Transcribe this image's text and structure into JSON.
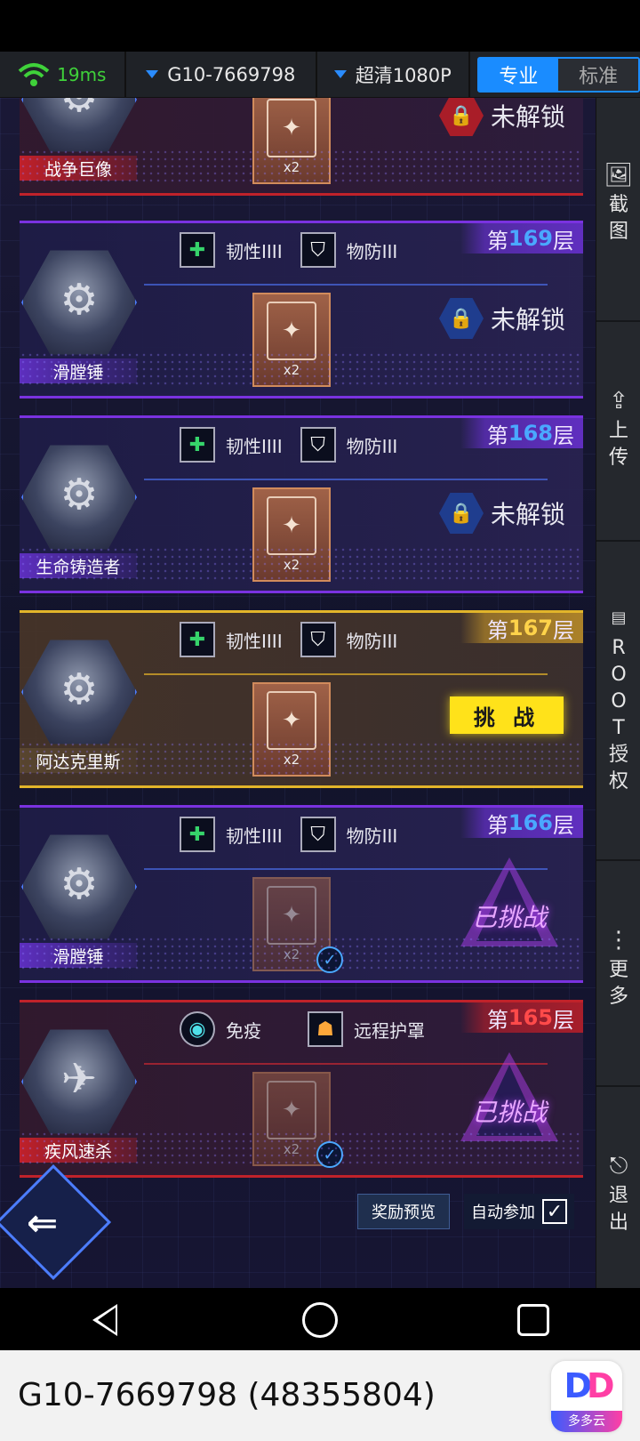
{
  "toolbar": {
    "ping": "19ms",
    "device": "G10-7669798",
    "quality": "超清1080P",
    "mode_pro": "专业",
    "mode_std": "标准"
  },
  "rows": [
    {
      "boss_name": "战争巨像",
      "floor_prefix": "",
      "floor_num": "",
      "floor_suffix": "",
      "status": "locked",
      "status_label": "未解锁",
      "reward_qty": "x2"
    },
    {
      "boss_name": "滑膛锤",
      "floor_prefix": "第",
      "floor_num": "169",
      "floor_suffix": "层",
      "trait1": "韧性IIII",
      "trait2": "物防III",
      "status": "locked",
      "status_label": "未解锁",
      "reward_qty": "x2"
    },
    {
      "boss_name": "生命铸造者",
      "floor_prefix": "第",
      "floor_num": "168",
      "floor_suffix": "层",
      "trait1": "韧性IIII",
      "trait2": "物防III",
      "status": "locked",
      "status_label": "未解锁",
      "reward_qty": "x2"
    },
    {
      "boss_name": "阿达克里斯",
      "floor_prefix": "第",
      "floor_num": "167",
      "floor_suffix": "层",
      "trait1": "韧性IIII",
      "trait2": "物防III",
      "status": "challenge",
      "status_label": "挑 战",
      "reward_qty": "x2"
    },
    {
      "boss_name": "滑膛锤",
      "floor_prefix": "第",
      "floor_num": "166",
      "floor_suffix": "层",
      "trait1": "韧性IIII",
      "trait2": "物防III",
      "status": "done",
      "status_label": "已挑战",
      "reward_qty": "x2"
    },
    {
      "boss_name": "疾风速杀",
      "floor_prefix": "第",
      "floor_num": "165",
      "floor_suffix": "层",
      "trait1": "免疫",
      "trait2": "远程护罩",
      "status": "done",
      "status_label": "已挑战",
      "reward_qty": "x2"
    }
  ],
  "footer": {
    "reward_preview": "奖励预览",
    "auto_join": "自动参加"
  },
  "sidebar": {
    "screenshot": [
      "截",
      "图"
    ],
    "upload": [
      "上",
      "传"
    ],
    "root": [
      "R",
      "O",
      "O",
      "T",
      "授",
      "权"
    ],
    "more": [
      "更",
      "多"
    ],
    "exit": [
      "退",
      "出"
    ]
  },
  "bottom": {
    "device_label": "G10-7669798 (48355804)",
    "logo_text": "DD",
    "logo_caption": "多多云"
  }
}
